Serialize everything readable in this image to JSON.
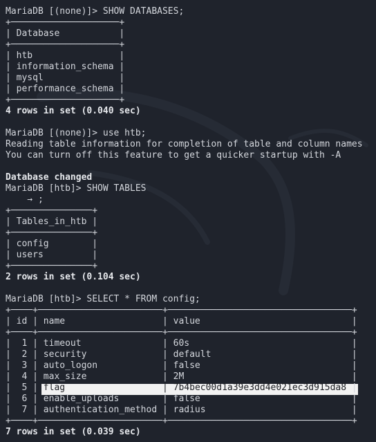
{
  "lines": [
    "MariaDB [(none)]> SHOW DATABASES;",
    "+────────────────────+",
    "| Database           |",
    "+────────────────────+",
    "| htb                |",
    "| information_schema |",
    "| mysql              |",
    "| performance_schema |",
    "+────────────────────+",
    "4 rows in set (0.040 sec)",
    "",
    "MariaDB [(none)]> use htb;",
    "Reading table information for completion of table and column names",
    "You can turn off this feature to get a quicker startup with -A",
    "",
    "Database changed",
    "MariaDB [htb]> SHOW TABLES",
    "    → ;",
    "+───────────────+",
    "| Tables_in_htb |",
    "+───────────────+",
    "| config        |",
    "| users         |",
    "+───────────────+",
    "2 rows in set (0.104 sec)",
    "",
    "MariaDB [htb]> SELECT * FROM config;",
    "+────+───────────────────────+──────────────────────────────────+",
    "| id | name                  | value                            |",
    "+────+───────────────────────+──────────────────────────────────+",
    "|  1 | timeout               | 60s                              |",
    "|  2 | security              | default                          |",
    "|  3 | auto_logon            | false                            |",
    "|  4 | max_size              | 2M                               |",
    "|  5 | flag                  | 7b4bec00d1a39e3dd4e021ec3d915da8 |",
    "|  6 | enable_uploads        | false                            |",
    "|  7 | authentication_method | radius                           |",
    "+────+───────────────────────+──────────────────────────────────+",
    "7 rows in set (0.039 sec)"
  ],
  "colors": {
    "background": "#1f232c",
    "foreground": "#d4d7dd",
    "selection_background": "#f2f2f2",
    "selection_foreground": "#1b1d22"
  }
}
